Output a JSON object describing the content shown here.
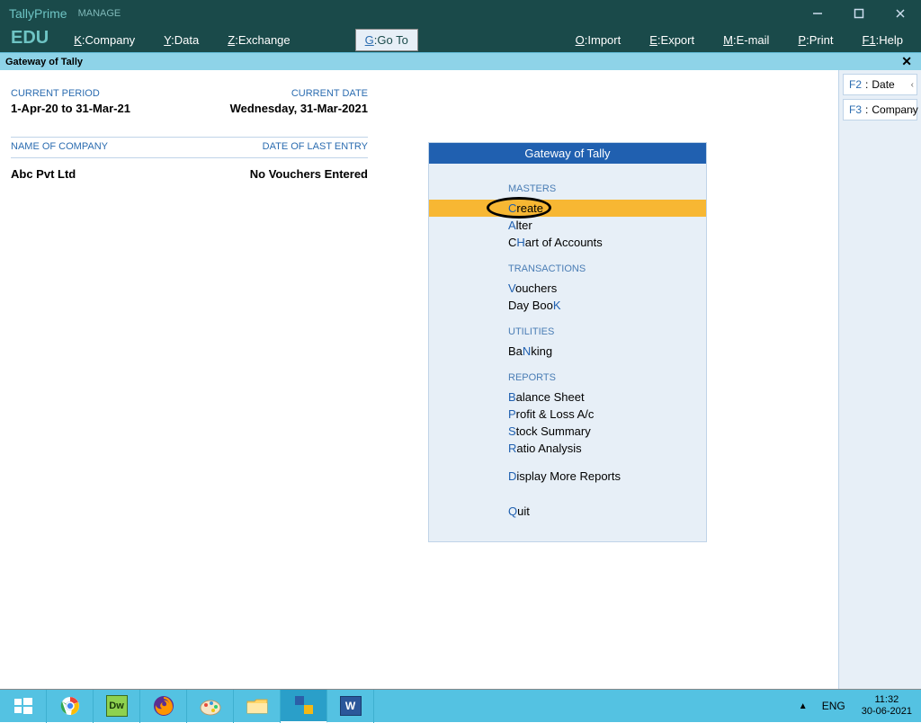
{
  "app_name": "TallyPrime",
  "edu_label": "EDU",
  "manage_label": "MANAGE",
  "menu": {
    "company": {
      "key": "K",
      "label": "Company"
    },
    "data": {
      "key": "Y",
      "label": "Data"
    },
    "exchange": {
      "key": "Z",
      "label": "Exchange"
    },
    "goto": {
      "key": "G",
      "label": "Go To"
    },
    "import": {
      "key": "O",
      "label": "Import"
    },
    "export": {
      "key": "E",
      "label": "Export"
    },
    "email": {
      "key": "M",
      "label": "E-mail"
    },
    "print": {
      "key": "P",
      "label": "Print"
    },
    "help": {
      "key": "F1",
      "label": "Help"
    }
  },
  "subheader": "Gateway of Tally",
  "left": {
    "current_period_label": "CURRENT PERIOD",
    "current_period_value": "1-Apr-20 to 31-Mar-21",
    "current_date_label": "CURRENT DATE",
    "current_date_value": "Wednesday, 31-Mar-2021",
    "company_label": "NAME OF COMPANY",
    "entry_label": "DATE OF LAST ENTRY",
    "company_value": "Abc Pvt Ltd",
    "entry_value": "No Vouchers Entered"
  },
  "gateway": {
    "title": "Gateway of Tally",
    "sections": {
      "masters": "MASTERS",
      "transactions": "TRANSACTIONS",
      "utilities": "UTILITIES",
      "reports": "REPORTS"
    },
    "items": {
      "create": "Create",
      "alter": "Alter",
      "chart": "CHart of Accounts",
      "vouchers": "Vouchers",
      "daybook": "Day BooK",
      "banking": "BaNking",
      "balance": "Balance Sheet",
      "pl": "Profit & Loss A/c",
      "stock": "Stock Summary",
      "ratio": "Ratio Analysis",
      "display": "Display More Reports",
      "quit": "Quit"
    }
  },
  "right_buttons": {
    "date": {
      "key": "F2",
      "label": "Date"
    },
    "company": {
      "key": "F3",
      "label": "Company"
    }
  },
  "tray": {
    "lang": "ENG",
    "time": "11:32",
    "date": "30-06-2021"
  }
}
